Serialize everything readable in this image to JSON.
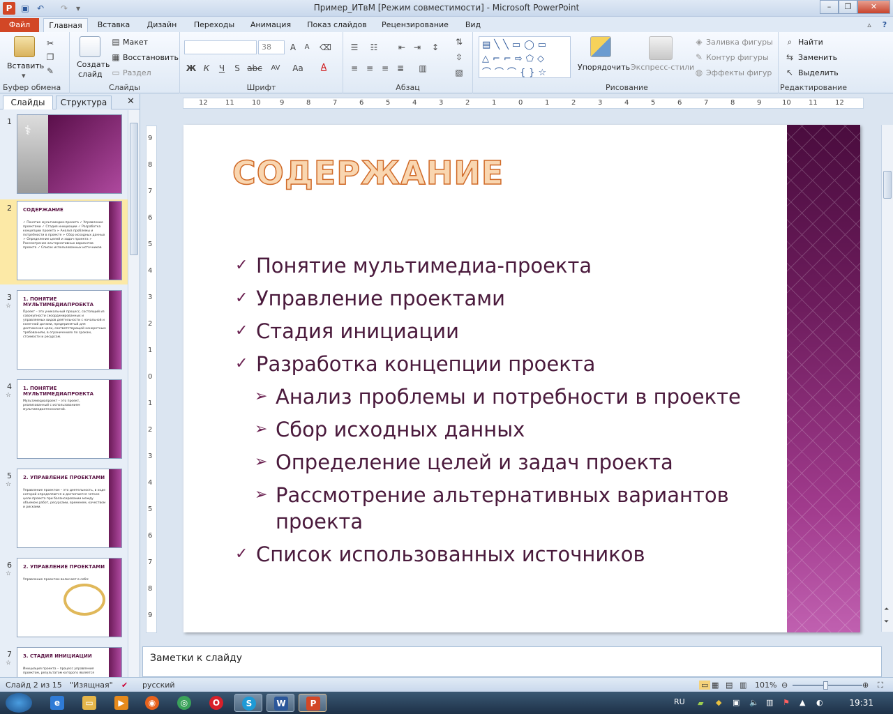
{
  "window": {
    "title": "Пример_ИТвМ [Режим совместимости]  -  Microsoft PowerPoint"
  },
  "tabs": {
    "file": "Файл",
    "home": "Главная",
    "insert": "Вставка",
    "design": "Дизайн",
    "transitions": "Переходы",
    "animation": "Анимация",
    "slideshow": "Показ слайдов",
    "review": "Рецензирование",
    "view": "Вид"
  },
  "ribbon": {
    "clipboard": {
      "paste": "Вставить",
      "label": "Буфер обмена"
    },
    "slides": {
      "new_slide_1": "Создать",
      "new_slide_2": "слайд",
      "layout": "Макет",
      "reset": "Восстановить",
      "section": "Раздел",
      "label": "Слайды"
    },
    "font": {
      "font_name": "",
      "font_size": "38",
      "bold": "Ж",
      "italic": "К",
      "underline": "Ч",
      "strike": "abc",
      "spacing": "AV",
      "case": "Aa",
      "color": "A",
      "label": "Шрифт"
    },
    "paragraph": {
      "label": "Абзац"
    },
    "drawing": {
      "arrange": "Упорядочить",
      "quick_styles": "Экспресс-стили",
      "fill": "Заливка фигуры",
      "outline": "Контур фигуры",
      "effects": "Эффекты фигур",
      "label": "Рисование"
    },
    "editing": {
      "find": "Найти",
      "replace": "Заменить",
      "select": "Выделить",
      "label": "Редактирование"
    }
  },
  "leftpane": {
    "tab_slides": "Слайды",
    "tab_outline": "Структура"
  },
  "thumbnails": [
    {
      "num": "1",
      "title": "",
      "body": "",
      "star": ""
    },
    {
      "num": "2",
      "title": "СОДЕРЖАНИЕ",
      "body": "✓ Понятие мультимедиа-проекта ✓ Управление проектами ✓ Стадия инициации ✓ Разработка концепции проекта ➢ Анализ проблемы и потребности в проекте ➢ Сбор исходных данных ➢ Определение целей и задач проекта ➢ Рассмотрение альтернативных вариантов проекта ✓ Список использованных источников",
      "star": ""
    },
    {
      "num": "3",
      "title": "1. ПОНЯТИЕ МУЛЬТИМЕДИАПРОЕКТА",
      "body": "Проект – это уникальный процесс, состоящий из совокупности скоординированных и управляемых видов деятельности с начальной и конечной датами, предпринятый для достижения цели, соответствующей конкретным требованиям, в ограничениях по срокам, стоимости и ресурсам.",
      "star": "☆"
    },
    {
      "num": "4",
      "title": "1. ПОНЯТИЕ МУЛЬТИМЕДИАПРОЕКТА",
      "body": "Мультимедиапроект – это проект, реализованный с использованием мультимедиатехнологий.",
      "star": "☆"
    },
    {
      "num": "5",
      "title": "2. УПРАВЛЕНИЕ ПРОЕКТАМИ",
      "body": "Управление проектом – это деятельность, в ходе которой определяются и достигаются четкие цели проекта при балансировании между объемом работ, ресурсами, временем, качеством и рисками.",
      "star": "☆"
    },
    {
      "num": "6",
      "title": "2. УПРАВЛЕНИЕ ПРОЕКТАМИ",
      "body": "Управление проектом включает в себя:",
      "star": "☆"
    },
    {
      "num": "7",
      "title": "3. СТАДИЯ ИНИЦИАЦИИ",
      "body": "Инициация проекта – процесс управления проектом, результатом которого является",
      "star": "☆"
    }
  ],
  "slide": {
    "title": "СОДЕРЖАНИЕ",
    "bullets": [
      {
        "text": "Понятие мультимедиа-проекта",
        "level": 1
      },
      {
        "text": "Управление проектами",
        "level": 1
      },
      {
        "text": "Стадия инициации",
        "level": 1
      },
      {
        "text": "Разработка концепции проекта",
        "level": 1
      },
      {
        "text": "Анализ проблемы и потребности в проекте",
        "level": 2
      },
      {
        "text": "Сбор исходных данных",
        "level": 2
      },
      {
        "text": "Определение целей и задач проекта",
        "level": 2
      },
      {
        "text": "Рассмотрение альтернативных вариантов проекта",
        "level": 2
      },
      {
        "text": "Список использованных источников",
        "level": 1
      }
    ]
  },
  "notes": {
    "placeholder": "Заметки к слайду"
  },
  "status": {
    "slide_counter": "Слайд 2 из 15",
    "theme": "\"Изящная\"",
    "language": "русский",
    "zoom": "101%"
  },
  "taskbar": {
    "lang": "RU",
    "time": "19:31"
  },
  "colors": {
    "accent": "#d24726",
    "slide_band": "#6c1c5c",
    "title_fill": "#f9d6b0",
    "title_stroke": "#d06a28",
    "bullet_text": "#4a1a3c"
  }
}
